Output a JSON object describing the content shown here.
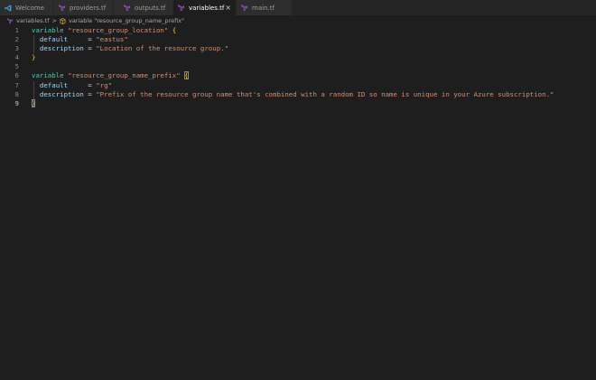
{
  "tabs": [
    {
      "label": "Welcome",
      "icon": "vscode-logo-icon",
      "active": false
    },
    {
      "label": "providers.tf",
      "icon": "terraform-icon",
      "active": false
    },
    {
      "label": "outputs.tf",
      "icon": "terraform-icon",
      "active": false
    },
    {
      "label": "variables.tf",
      "icon": "terraform-icon",
      "active": true,
      "close": "×"
    },
    {
      "label": "main.tf",
      "icon": "terraform-icon",
      "active": false
    }
  ],
  "breadcrumb": {
    "file": "variables.tf",
    "separator": ">",
    "symbol": "variable \"resource_group_name_prefix\""
  },
  "editor": {
    "lines": [
      {
        "num": "1",
        "tokens": [
          [
            "kw",
            "variable"
          ],
          [
            "op",
            " "
          ],
          [
            "str",
            "\"resource_group_location\""
          ],
          [
            "op",
            " "
          ],
          [
            "brace",
            "{"
          ]
        ]
      },
      {
        "num": "2",
        "tokens": [
          [
            "op",
            "  "
          ],
          [
            "attr",
            "default"
          ],
          [
            "op",
            "     = "
          ],
          [
            "str",
            "\"eastus\""
          ]
        ]
      },
      {
        "num": "3",
        "tokens": [
          [
            "op",
            "  "
          ],
          [
            "attr",
            "description"
          ],
          [
            "op",
            " = "
          ],
          [
            "str",
            "\"Location of the resource group.\""
          ]
        ]
      },
      {
        "num": "4",
        "tokens": [
          [
            "brace",
            "}"
          ]
        ]
      },
      {
        "num": "5",
        "tokens": []
      },
      {
        "num": "6",
        "tokens": [
          [
            "kw",
            "variable"
          ],
          [
            "op",
            " "
          ],
          [
            "str",
            "\"resource_group_name_prefix\""
          ],
          [
            "op",
            " "
          ],
          [
            "brace-match",
            "{"
          ]
        ]
      },
      {
        "num": "7",
        "tokens": [
          [
            "op",
            "  "
          ],
          [
            "attr",
            "default"
          ],
          [
            "op",
            "     = "
          ],
          [
            "str",
            "\"rg\""
          ]
        ]
      },
      {
        "num": "8",
        "tokens": [
          [
            "op",
            "  "
          ],
          [
            "attr",
            "description"
          ],
          [
            "op",
            " = "
          ],
          [
            "str",
            "\"Prefix of the resource group name that's combined with a random ID so name is unique in your Azure subscription.\""
          ]
        ]
      },
      {
        "num": "9",
        "tokens": [
          [
            "brace-match",
            "}"
          ]
        ],
        "current": true
      }
    ]
  },
  "colors": {
    "background": "#1e1e1e",
    "keyword": "#4ec9b0",
    "string": "#ce9178",
    "attribute": "#9cdcfe",
    "brace": "#ffd700",
    "terraform": "#844fba"
  }
}
